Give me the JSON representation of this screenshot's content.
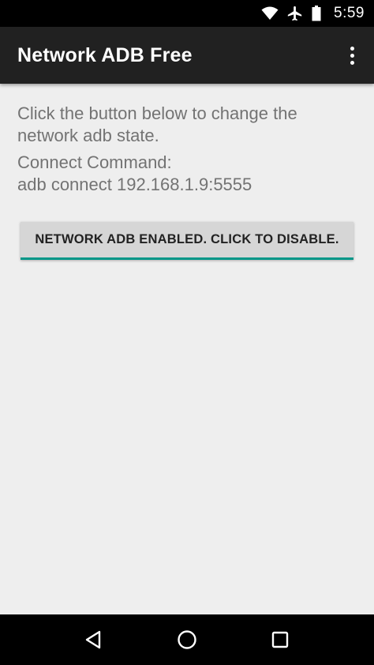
{
  "status_bar": {
    "time": "5:59",
    "icons": [
      "wifi-icon",
      "airplane-mode-icon",
      "battery-icon"
    ]
  },
  "app_bar": {
    "title": "Network ADB Free",
    "overflow_icon": "more-vert-icon"
  },
  "content": {
    "instruction": "Click the button below to change the network adb state.",
    "connect_label": "Connect Command:",
    "connect_command": "adb connect 192.168.1.9:5555",
    "toggle_button_label": "NETWORK ADB ENABLED. CLICK TO DISABLE."
  },
  "nav_bar": {
    "icons": [
      "back-icon",
      "home-icon",
      "recents-icon"
    ]
  },
  "colors": {
    "app_bar": "#212121",
    "background": "#eeeeee",
    "text_secondary": "#737373",
    "accent_underline": "#009688",
    "button_bg": "#d6d6d6"
  }
}
